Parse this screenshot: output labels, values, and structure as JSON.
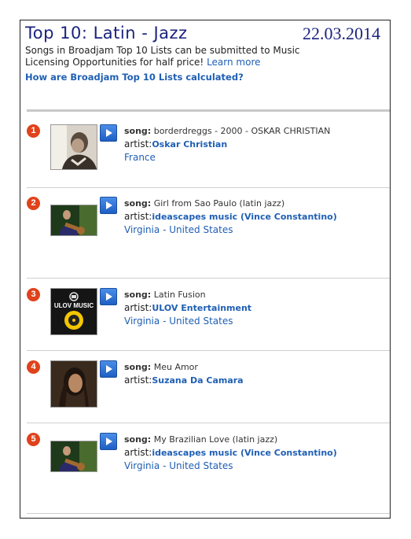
{
  "header": {
    "title": "Top 10: Latin - Jazz",
    "date": "22.03.2014",
    "intro": "Songs in Broadjam Top 10 Lists can be submitted to Music Licensing Opportunities for half price!",
    "learn_more": "Learn more",
    "calc_link": "How are Broadjam Top 10 Lists calculated?"
  },
  "labels": {
    "song": "song:",
    "artist": "artist:",
    "loc_sep": " - "
  },
  "items": [
    {
      "rank": "1",
      "song": "borderdreggs - 2000 - OSKAR CHRISTIAN",
      "artist": "Oskar Christian",
      "loc1": "France",
      "loc2": ""
    },
    {
      "rank": "2",
      "song": "Girl from Sao Paulo (latin jazz)",
      "artist": "ideascapes music (Vince Constantino)",
      "loc1": "Virginia",
      "loc2": "United States"
    },
    {
      "rank": "3",
      "song": "Latin Fusion",
      "artist": "ULOV Entertainment",
      "loc1": "Virginia",
      "loc2": "United States",
      "thumb_text": "ULOV MUSIC"
    },
    {
      "rank": "4",
      "song": "Meu Amor",
      "artist": "Suzana Da Camara",
      "loc1": "",
      "loc2": ""
    },
    {
      "rank": "5",
      "song": "My Brazilian Love (latin jazz)",
      "artist": "ideascapes music (Vince Constantino)",
      "loc1": "Virginia",
      "loc2": "United States"
    }
  ]
}
